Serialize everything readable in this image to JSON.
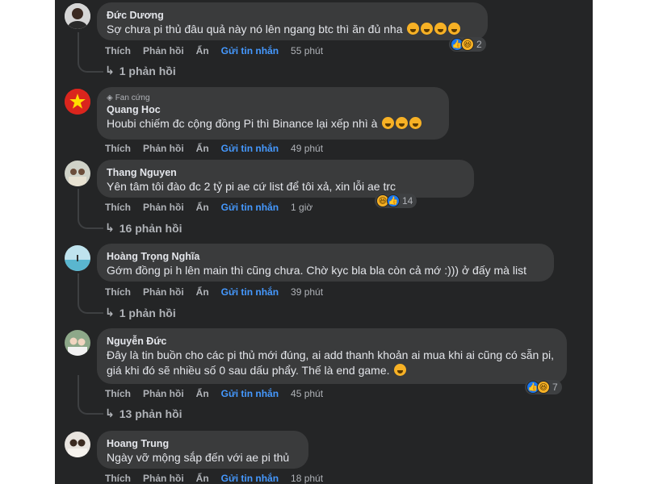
{
  "labels": {
    "like": "Thích",
    "reply": "Phản hồi",
    "hide": "Ẩn",
    "send": "Gửi tin nhắn"
  },
  "comments": [
    {
      "author": "Đức Dương",
      "text": "Sợ chưa pi thủ đâu quả này nó lên ngang btc thì ăn đủ nha",
      "time": "55 phút",
      "reaction_count": "2",
      "replies": "1 phản hồi"
    },
    {
      "badge": "Fan cứng",
      "author": "Quang Hoc",
      "text": "Houbi chiếm đc cộng đồng Pi thì Binance lại xếp nhì à",
      "time": "49 phút"
    },
    {
      "author": "Thang Nguyen",
      "text": "Yên tâm tôi đào đc 2 tỷ pi ae cứ list để tôi xả, xin lỗi ae trc",
      "time": "1 giờ",
      "reaction_count": "14",
      "replies": "16 phản hồi"
    },
    {
      "author": "Hoàng Trọng Nghĩa",
      "text": "Gớm đồng pi h lên main thì cũng chưa. Chờ kyc bla bla còn cả mớ :))) ở đấy mà list",
      "time": "39 phút",
      "replies": "1 phản hồi"
    },
    {
      "author": "Nguyễn Đức",
      "text": "Đây là tin buồn cho các pi thủ mới đúng, ai add thanh khoản ai mua khi ai cũng có sẵn pi, giá khi đó sẽ nhiều số 0 sau dấu phẩy. Thế là end game.",
      "time": "45 phút",
      "reaction_count": "7",
      "replies": "13 phản hồi"
    },
    {
      "author": "Hoang Trung",
      "text": "Ngày vỡ mộng sắp đến với ae pi thủ",
      "time": "18 phút"
    }
  ],
  "colors": {
    "panel_bg": "#242526",
    "bubble_bg": "#3a3b3c",
    "link_blue": "#4599ff"
  }
}
